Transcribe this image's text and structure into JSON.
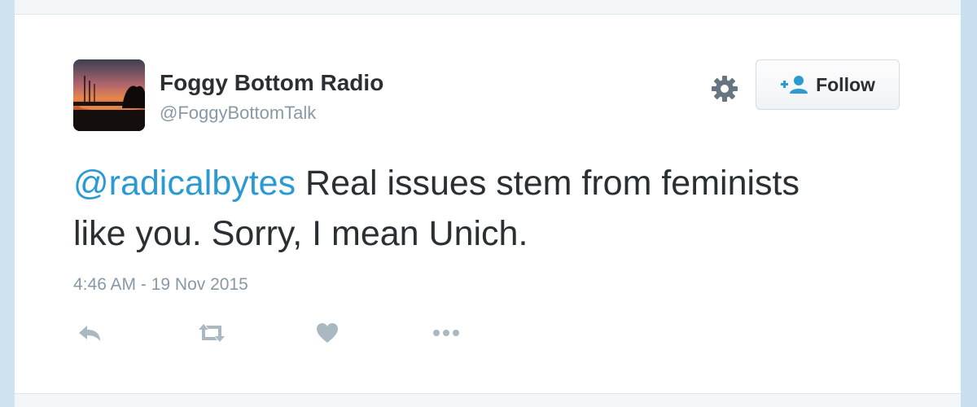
{
  "tweet": {
    "author_name": "Foggy Bottom Radio",
    "author_handle": "@FoggyBottomTalk",
    "mention": "@radicalbytes",
    "text_body": " Real issues stem from feminists like you. Sorry, I mean Unich.",
    "timestamp": "4:46 AM - 19 Nov 2015"
  },
  "header": {
    "follow_label": "Follow"
  },
  "colors": {
    "link": "#2b9ad3",
    "text": "#292f33",
    "muted": "#8899a6",
    "icon": "#aab8c2"
  },
  "actions": [
    "reply-icon",
    "retweet-icon",
    "like-icon",
    "more-icon"
  ]
}
